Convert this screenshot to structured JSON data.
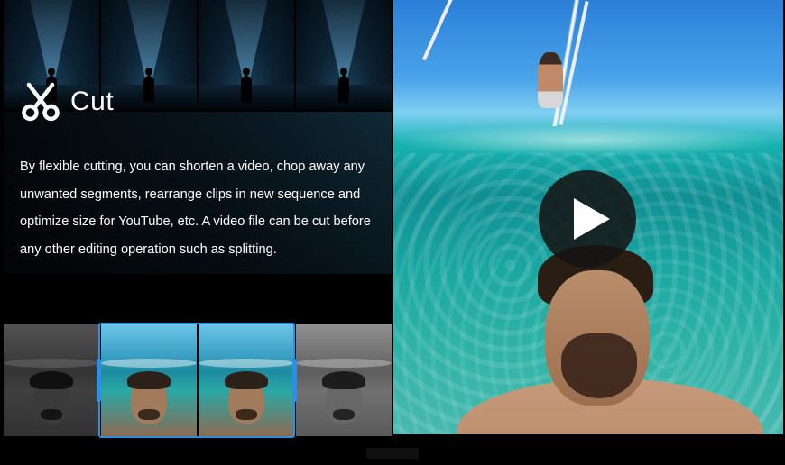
{
  "feature": {
    "title": "Cut",
    "icon": "scissors-icon",
    "description": "By flexible cutting, you can shorten a video, chop away any unwanted segments, rearrange clips in new sequence and optimize size for YouTube, etc. A video file can be cut before any other editing operation such as splitting."
  },
  "top_thumbnails": [
    {
      "scene": "night-light-beam"
    },
    {
      "scene": "night-light-beam"
    },
    {
      "scene": "night-light-beam"
    },
    {
      "scene": "night-light-beam"
    }
  ],
  "clip_strip": {
    "clips": [
      {
        "selected": false
      },
      {
        "selected": true
      },
      {
        "selected": true
      },
      {
        "selected": false
      }
    ],
    "selection_color": "#2b8fe6"
  },
  "player": {
    "play_icon": "play-icon"
  },
  "colors": {
    "background": "#000000",
    "text": "#ffffff",
    "accent": "#2b8fe6"
  }
}
